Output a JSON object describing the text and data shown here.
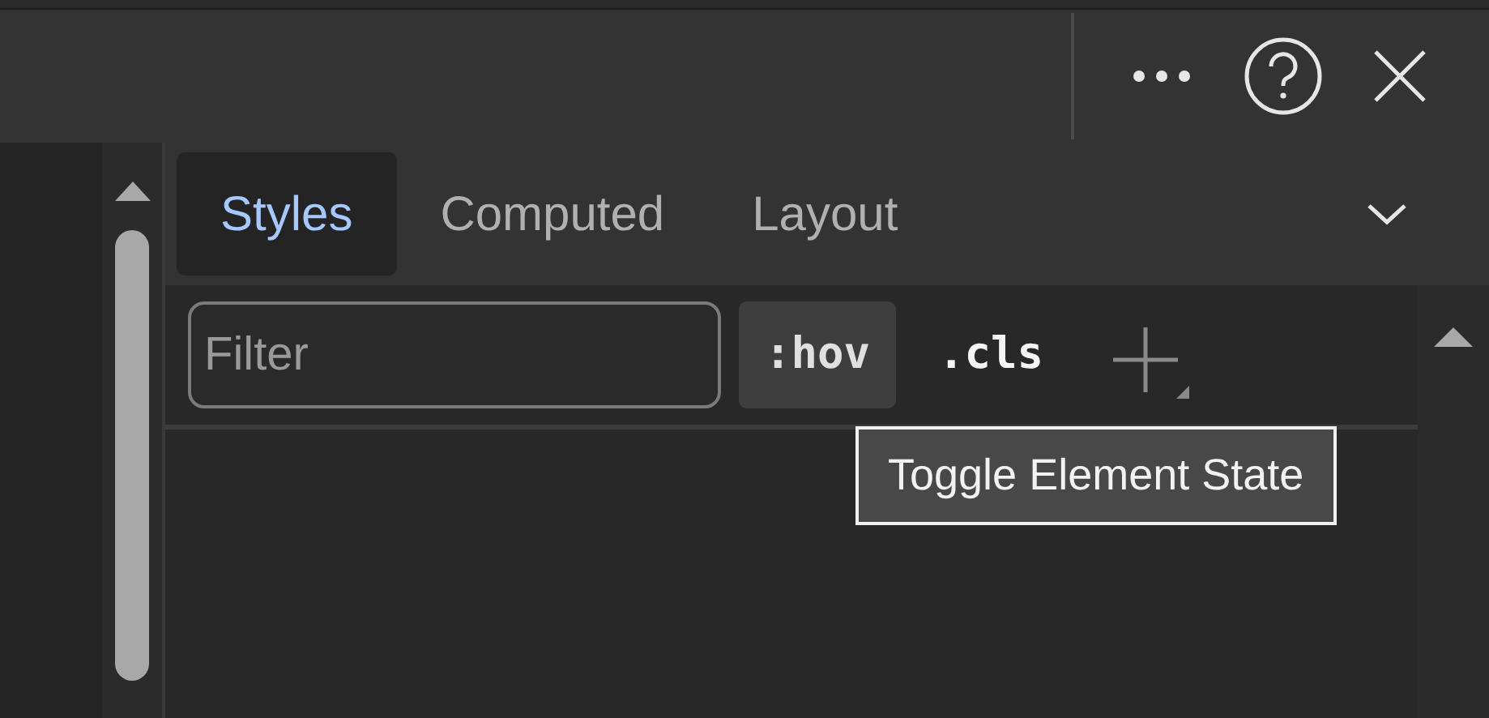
{
  "tabs": [
    {
      "label": "Styles",
      "selected": true
    },
    {
      "label": "Computed",
      "selected": false
    },
    {
      "label": "Layout",
      "selected": false
    }
  ],
  "filter": {
    "placeholder": "Filter"
  },
  "toolbar_buttons": [
    {
      "label": ":hov",
      "highlighted": true
    },
    {
      "label": ".cls",
      "highlighted": false
    }
  ],
  "tooltip": "Toggle Element State"
}
